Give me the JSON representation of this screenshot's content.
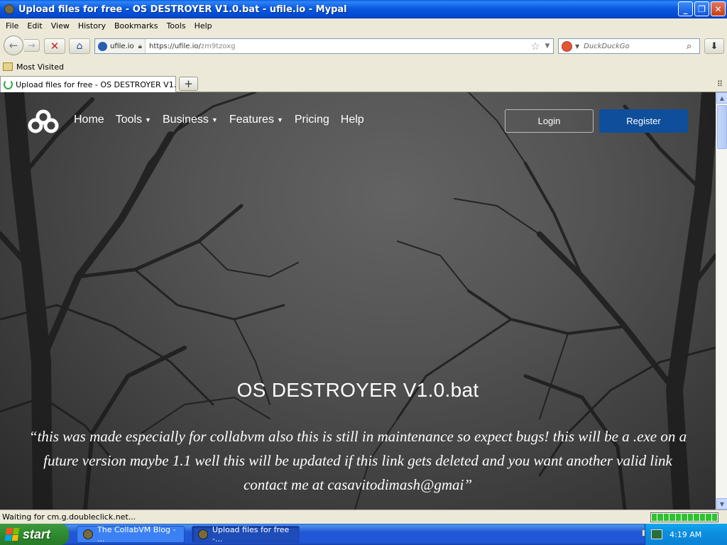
{
  "window": {
    "title": "Upload files for free - OS DESTROYER V1.0.bat - ufile.io - Mypal",
    "minimize": "_",
    "maximize": "❐",
    "close": "✕"
  },
  "menu": [
    "File",
    "Edit",
    "View",
    "History",
    "Bookmarks",
    "Tools",
    "Help"
  ],
  "toolbar": {
    "site_identity": "ufile.io",
    "url_prefix": "https://ufile.io/",
    "url_path": "zm9tzoxg",
    "search_placeholder": "DuckDuckGo"
  },
  "bookmarks": {
    "most_visited": "Most Visited"
  },
  "tabs": {
    "active_label": "Upload files for free - OS DESTROYER V1.0....",
    "new_tab": "+"
  },
  "site": {
    "nav": [
      {
        "label": "Home",
        "dropdown": false
      },
      {
        "label": "Tools",
        "dropdown": true
      },
      {
        "label": "Business",
        "dropdown": true
      },
      {
        "label": "Features",
        "dropdown": true
      },
      {
        "label": "Pricing",
        "dropdown": false
      },
      {
        "label": "Help",
        "dropdown": false
      }
    ],
    "login": "Login",
    "register": "Register",
    "file_title": "OS DESTROYER V1.0.bat",
    "description": "“this was made especially for collabvm also this is still in maintenance so expect bugs! this will be a .exe on a future version maybe 1.1 well this will be updated if this link gets deleted and you want another valid link contact me at casavitodimash@gmai”"
  },
  "status": {
    "text": "Waiting for cm.g.doubleclick.net...",
    "progress_fraction": 1.0
  },
  "taskbar": {
    "start": "start",
    "tasks": [
      {
        "label": "The CollabVM Blog - ...",
        "active": false
      },
      {
        "label": "Upload files for free -...",
        "active": true
      }
    ],
    "clock": "4:19 AM"
  },
  "colors": {
    "register_button": "#0e4e9b",
    "xp_blue": "#0A5AE0",
    "xp_green": "#2e8b2e"
  }
}
